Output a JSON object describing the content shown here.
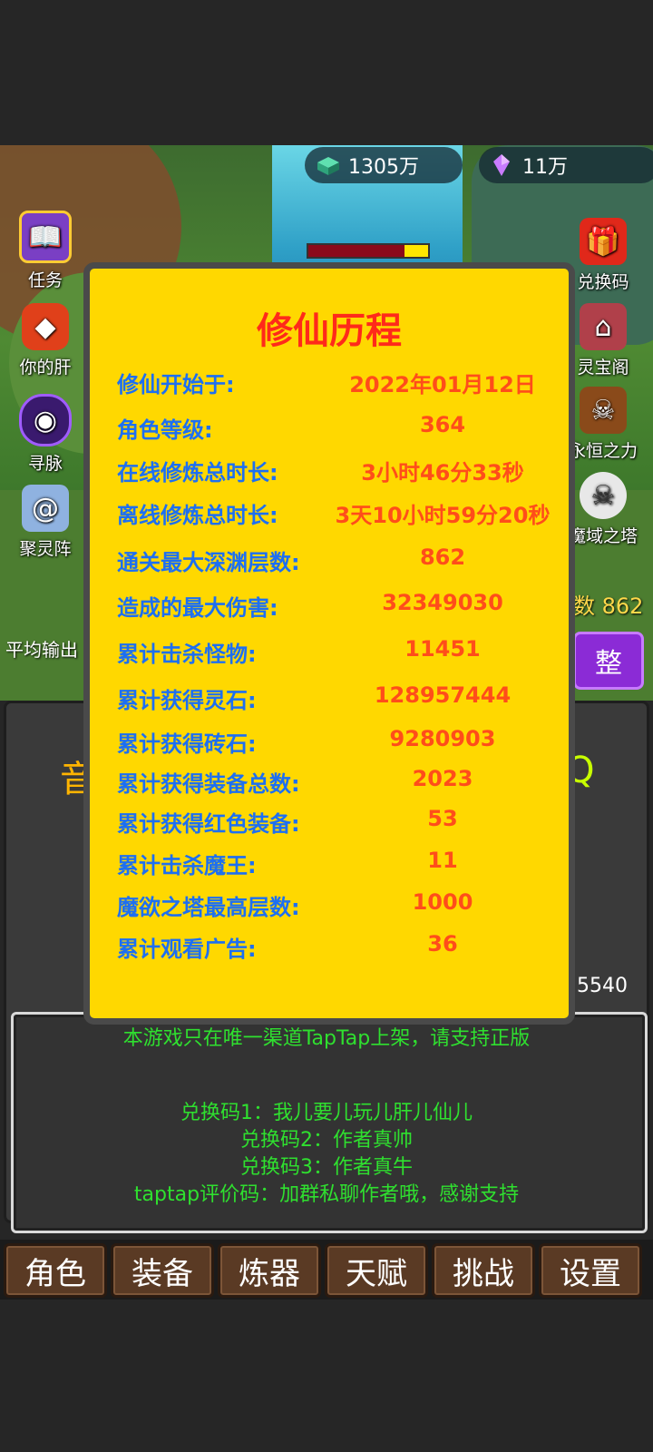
{
  "currency": {
    "jade": "1305万",
    "crystal": "11万"
  },
  "side_left": [
    "任务",
    "你的肝",
    "寻脉",
    "聚灵阵"
  ],
  "side_right": [
    "兑换码",
    "灵宝阁",
    "永恒之力",
    "魔域之塔"
  ],
  "scene": {
    "floor_text": "数 862",
    "avg_output": "平均输出",
    "adjust_button": "整",
    "deco_left": "音",
    "deco_right": "Q",
    "partial_number": "5540"
  },
  "modal": {
    "title": "修仙历程",
    "stats": [
      {
        "label": "修仙开始于:",
        "value": "2022年01月12日"
      },
      {
        "label": "角色等级:",
        "value": "364"
      },
      {
        "label": "在线修炼总时长:",
        "value": "3小时46分33秒"
      },
      {
        "label": "离线修炼总时长:",
        "value": "3天10小时59分20秒"
      },
      {
        "label": "通关最大深渊层数:",
        "value": "862"
      },
      {
        "label": "造成的最大伤害:",
        "value": "32349030"
      },
      {
        "label": "累计击杀怪物:",
        "value": "11451"
      },
      {
        "label": "累计获得灵石:",
        "value": "128957444"
      },
      {
        "label": "累计获得砖石:",
        "value": "9280903"
      },
      {
        "label": "累计获得装备总数:",
        "value": "2023"
      },
      {
        "label": "累计获得红色装备:",
        "value": "53"
      },
      {
        "label": "累计击杀魔王:",
        "value": "11"
      },
      {
        "label": "魔欲之塔最高层数:",
        "value": "1000"
      },
      {
        "label": "累计观看广告:",
        "value": "36"
      }
    ]
  },
  "notice": {
    "line1": "本游戏只在唯一渠道TapTap上架，请支持正版",
    "line2": "兑换码1：我儿要儿玩儿肝儿仙儿",
    "line3": "兑换码2：作者真帅",
    "line4": "兑换码3：作者真牛",
    "line5": "taptap评价码：加群私聊作者哦，感谢支持"
  },
  "tabs": [
    "角色",
    "装备",
    "炼器",
    "天赋",
    "挑战",
    "设置"
  ],
  "colors": {
    "modal_bg": "#ffd800",
    "title": "#ff2a1a",
    "label": "#1d6ff2",
    "value": "#ff4d1a",
    "notice_text": "#2fe02f"
  }
}
